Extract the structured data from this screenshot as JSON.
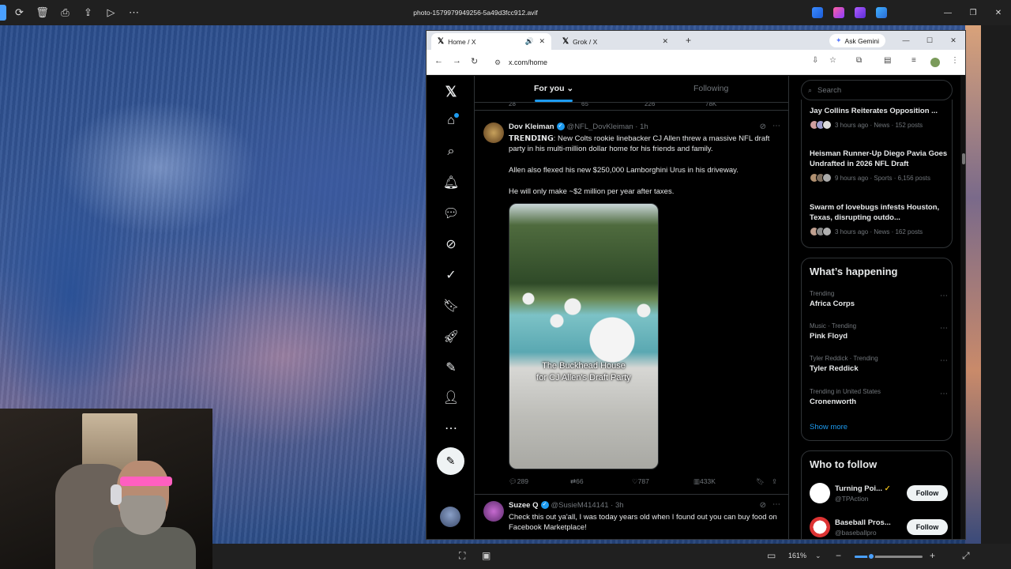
{
  "viewer": {
    "file_name": "photo-1579979949256-5a49d3fcc912.avif",
    "zoom": "161%",
    "zoom_fraction": 0.24
  },
  "browser": {
    "tabs": [
      {
        "title": "Home / X",
        "active": true
      },
      {
        "title": "Grok / X",
        "active": false
      }
    ],
    "ask_gemini": "Ask Gemini",
    "url": "x.com/home"
  },
  "feed": {
    "tabs": {
      "for_you": "For you",
      "following": "Following"
    },
    "prev_actions": {
      "replies": "28",
      "reposts": "65",
      "likes": "226",
      "views": "78K"
    },
    "tweets": [
      {
        "name": "Dov Kleiman",
        "handle": "@NFL_DovKleiman",
        "time": "1h",
        "paragraphs": [
          "𝗧𝗥𝗘𝗡𝗗𝗜𝗡𝗚: New Colts rookie linebacker CJ Allen threw a massive NFL draft party in his multi-million dollar home for his friends and family.",
          "Allen also flexed his new $250,000 Lamborghini Urus in his driveway.",
          "He will only make ~$2 million per year after taxes."
        ],
        "media_caption_1": "The Buckhead House",
        "media_caption_2": "for CJ Allen's Draft Party",
        "replies": "289",
        "reposts": "66",
        "likes": "787",
        "views": "433K"
      },
      {
        "name": "Suzee Q",
        "handle": "@SusieM414141",
        "time": "3h",
        "text": "Check this out ya'all, I was today years old when I found out you can buy food on Facebook Marketplace!"
      }
    ]
  },
  "sidebar": {
    "search_placeholder": "Search",
    "news": [
      {
        "title": "Jay Collins Reiterates Opposition ...",
        "meta": "3 hours ago · News · 152 posts"
      },
      {
        "title": "Heisman Runner-Up Diego Pavia Goes Undrafted in 2026 NFL Draft",
        "meta": "9 hours ago · Sports · 6,156 posts"
      },
      {
        "title": "Swarm of lovebugs infests Houston, Texas, disrupting outdo...",
        "meta": "3 hours ago · News · 162 posts"
      }
    ],
    "whats_happening": "What’s happening",
    "trends": [
      {
        "meta": "Trending",
        "name": "Africa Corps"
      },
      {
        "meta": "Music · Trending",
        "name": "Pink Floyd"
      },
      {
        "meta": "Tyler Reddick · Trending",
        "name": "Tyler Reddick"
      },
      {
        "meta": "Trending in United States",
        "name": "Cronenworth"
      }
    ],
    "show_more": "Show more",
    "who_to_follow": "Who to follow",
    "follow_suggestions": [
      {
        "name": "Turning Poi...",
        "handle": "@TPAction",
        "button": "Follow"
      },
      {
        "name": "Baseball Pros...",
        "handle": "@baseballpro",
        "button": "Follow"
      }
    ]
  },
  "colors": {
    "accent": "#1d9bf0",
    "background": "#000000"
  }
}
